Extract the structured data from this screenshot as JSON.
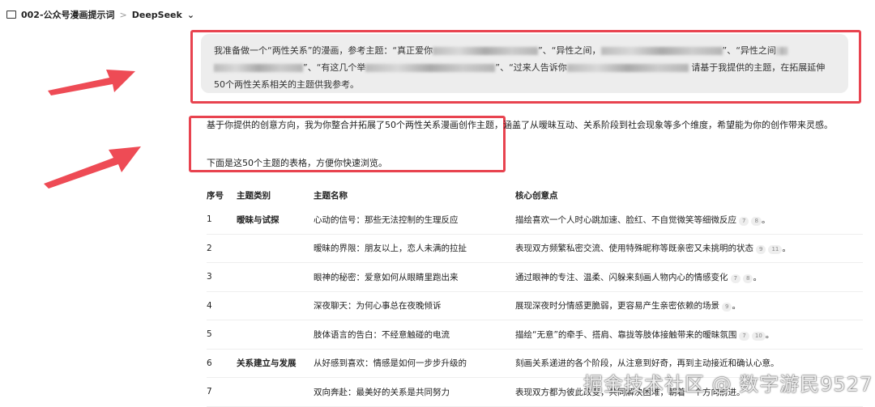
{
  "breadcrumb": {
    "folder": "002-公众号漫画提示词",
    "separator": ">",
    "current": "DeepSeek",
    "chevron": "⌄"
  },
  "user_message": {
    "p1": "我准备做一个“两性关系”的漫画，参考主题：“真正爱你",
    "p2": "”、“异性之间，",
    "p3": "”、“异性之间",
    "p4": "”、“有这几个举",
    "p5": "”、“过来人告诉你",
    "p6": "请基于我提供的主题，在拓展延伸50个两性关系相关的主题供我参考。"
  },
  "response": {
    "intro": "基于你提供的创意方向，我为你整合并拓展了50个两性关系漫画创作主题，涵盖了从暧昧互动、关系阶段到社会现象等多个维度，希望能为你的创作带来灵感。",
    "lead": "下面是这50个主题的表格，方便你快速浏览。"
  },
  "table": {
    "headers": [
      "序号",
      "主题类别",
      "主题名称",
      "核心创意点"
    ],
    "rows": [
      {
        "no": "1",
        "category": "暧昧与试探",
        "name": "心动的信号：那些无法控制的生理反应",
        "idea": "描绘喜欢一个人时心跳加速、脸红、不自觉微笑等细微反应",
        "cites": [
          "7",
          "8"
        ],
        "end": "。"
      },
      {
        "no": "2",
        "category": "",
        "name": "暧昧的界限：朋友以上，恋人未满的拉扯",
        "idea": "表现双方频繁私密交流、使用特殊昵称等既亲密又未挑明的状态",
        "cites": [
          "9",
          "11"
        ],
        "end": "。"
      },
      {
        "no": "3",
        "category": "",
        "name": "眼神的秘密：爱意如何从眼睛里跑出来",
        "idea": "通过眼神的专注、温柔、闪躲来刻画人物内心的情感变化",
        "cites": [
          "7",
          "8"
        ],
        "end": "。"
      },
      {
        "no": "4",
        "category": "",
        "name": "深夜聊天：为何心事总在夜晚倾诉",
        "idea": "展现深夜时分情感更脆弱，更容易产生亲密依赖的场景",
        "cites": [
          "9"
        ],
        "end": "。"
      },
      {
        "no": "5",
        "category": "",
        "name": "肢体语言的告白：不经意触碰的电流",
        "idea": "描绘“无意”的牵手、搭肩、靠拢等肢体接触带来的暧昧氛围",
        "cites": [
          "7",
          "10"
        ],
        "end": "。"
      },
      {
        "no": "6",
        "category": "关系建立与发展",
        "name": "从好感到喜欢：情感是如何一步步升级的",
        "idea": "刻画关系递进的各个阶段，从注意到好奇，再到主动接近和确认心意。",
        "cites": [],
        "end": ""
      },
      {
        "no": "7",
        "category": "",
        "name": "双向奔赴：最美好的关系是共同努力",
        "idea": "表现双方都为彼此改变，共同解决困难，朝着一个方向前进。",
        "cites": [],
        "end": ""
      }
    ]
  },
  "watermark": "掘金技术社区 @ 数字游民9527"
}
